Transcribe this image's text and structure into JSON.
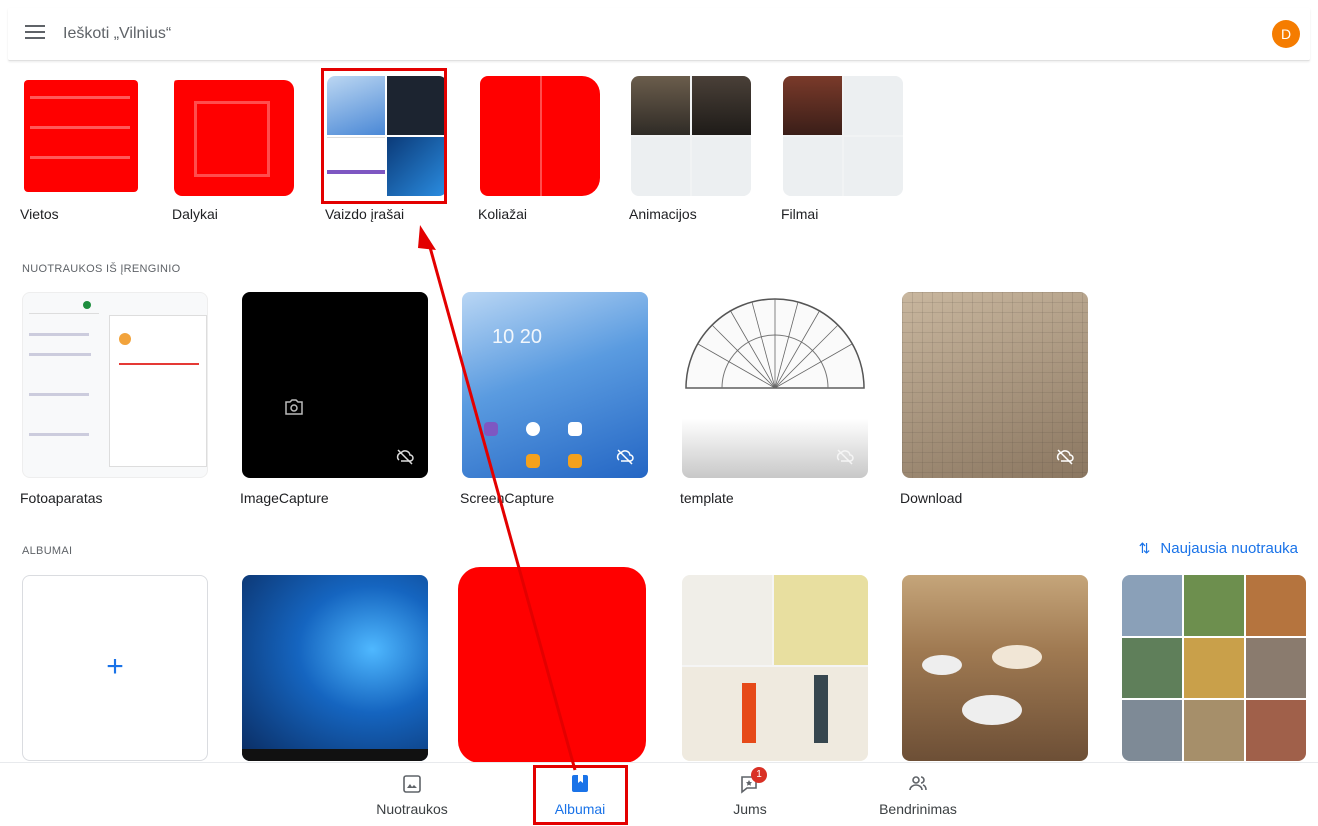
{
  "search": {
    "placeholder": "Ieškoti „Vilnius“"
  },
  "account": {
    "avatar_letter": "D"
  },
  "categories": [
    {
      "label": "Vietos"
    },
    {
      "label": "Dalykai"
    },
    {
      "label": "Vaizdo įrašai"
    },
    {
      "label": "Koliažai"
    },
    {
      "label": "Animacijos"
    },
    {
      "label": "Filmai"
    }
  ],
  "device_section": {
    "title": "NUOTRAUKOS IŠ ĮRENGINIO"
  },
  "device_folders": [
    {
      "label": "Fotoaparatas"
    },
    {
      "label": "ImageCapture"
    },
    {
      "label": "ScreenCapture",
      "clock": "10 20"
    },
    {
      "label": "template"
    },
    {
      "label": "Download"
    }
  ],
  "albums_section": {
    "title": "ALBUMAI",
    "sort_label": "Naujausia nuotrauka"
  },
  "bottom_nav": [
    {
      "label": "Nuotraukos"
    },
    {
      "label": "Albumai"
    },
    {
      "label": "Jums",
      "badge": "1"
    },
    {
      "label": "Bendrinimas"
    }
  ],
  "colors": {
    "accent": "#1a73e8",
    "annotation": "#e30000",
    "avatar": "#f57c00"
  }
}
